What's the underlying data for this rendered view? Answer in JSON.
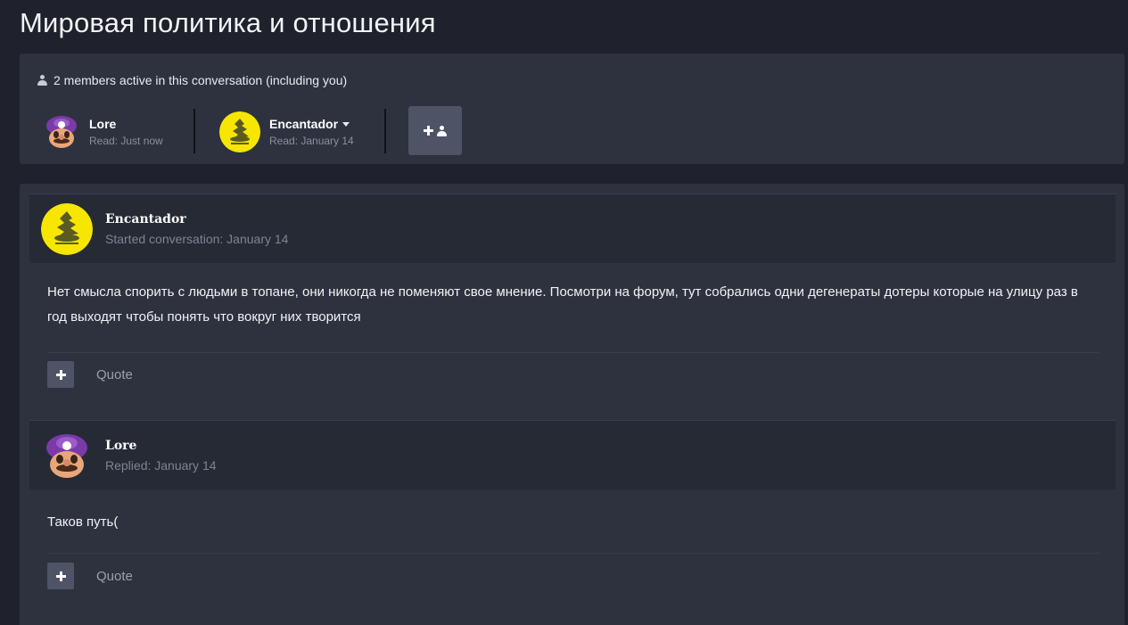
{
  "page": {
    "title": "Мировая политика и отношения"
  },
  "participants": {
    "active_text": "2 members active in this conversation (including you)",
    "members": [
      {
        "name": "Lore",
        "read": "Read: Just now",
        "avatar_icon": "mario-avatar"
      },
      {
        "name": "Encantador",
        "read": "Read: January 14",
        "avatar_icon": "gadsden-flag-avatar",
        "has_dropdown": true
      }
    ],
    "invite_icon": "add-user-icon"
  },
  "messages": [
    {
      "author": "Encantador",
      "meta": "Started conversation: January 14",
      "avatar_icon": "gadsden-flag-avatar",
      "body": "Нет смысла спорить с людьми в топане, они никогда не поменяют свое мнение. Посмотри на форум, тут собрались одни дегенераты дотеры которые на улицу раз в год выходят чтобы понять что вокруг них творится",
      "quote_label": "Quote"
    },
    {
      "author": "Lore",
      "meta": "Replied: January 14",
      "avatar_icon": "mario-avatar",
      "body": "Таков путь(",
      "quote_label": "Quote"
    }
  ],
  "colors": {
    "background": "#1f222c",
    "panel": "#2e323f",
    "header_strip": "#262a35",
    "button": "#4e5466",
    "muted_text": "#8a8f9e",
    "flag_yellow": "#f7e600"
  }
}
